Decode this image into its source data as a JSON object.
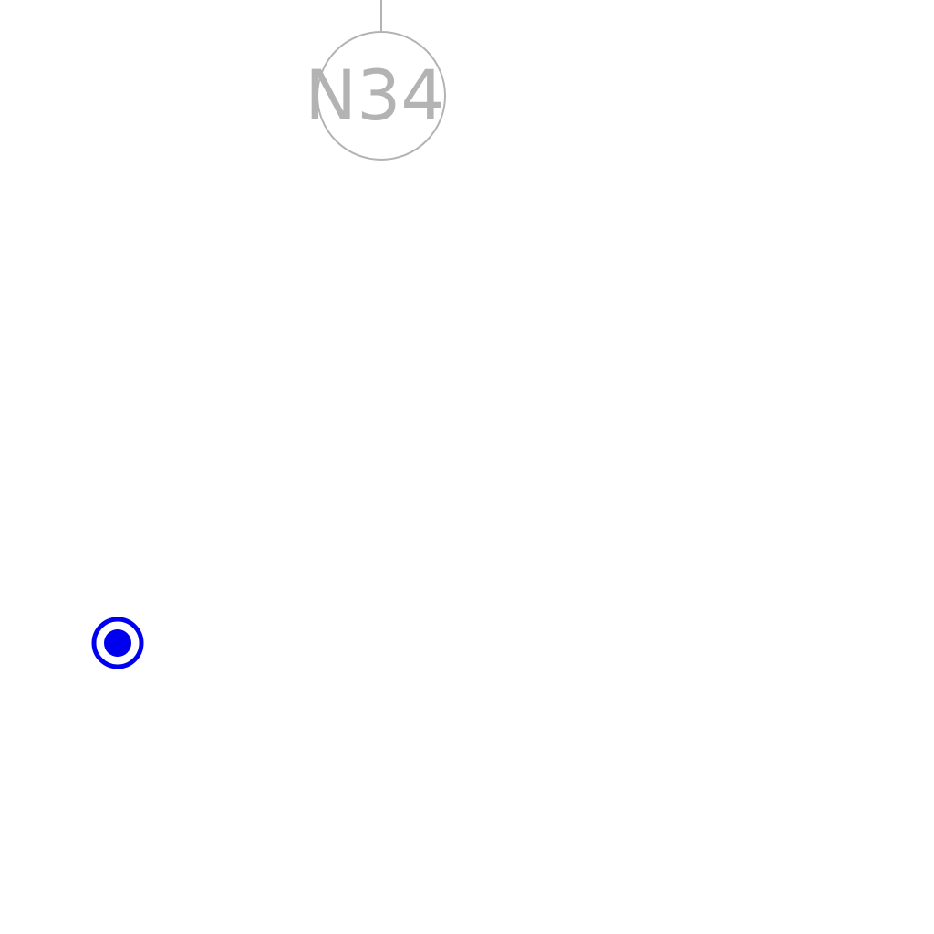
{
  "map": {
    "node": {
      "label": "N34",
      "color": "#b3b3b3"
    },
    "location_marker": {
      "icon": "location-marker-icon",
      "color": "#0000ee"
    },
    "background": "#ffffff"
  }
}
